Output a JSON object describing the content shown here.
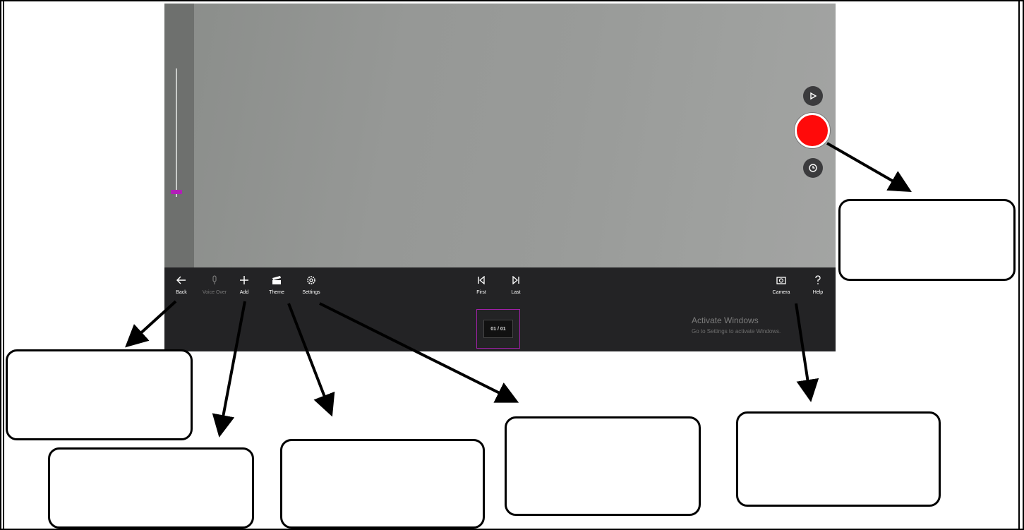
{
  "app": {
    "toolbar": {
      "back_label": "Back",
      "voice_over_label": "Voice Over",
      "add_label": "Add",
      "theme_label": "Theme",
      "settings_label": "Settings",
      "first_label": "First",
      "last_label": "Last",
      "camera_label": "Camera",
      "help_label": "Help"
    },
    "frame_counter": "01 / 01",
    "activation": {
      "title": "Activate Windows",
      "subtitle": "Go to Settings to activate Windows."
    },
    "colors": {
      "record": "#ff0a0a",
      "accent": "#b21fb8",
      "toolbar_bg": "#232325"
    },
    "icons": [
      "back-arrow-icon",
      "microphone-icon",
      "plus-icon",
      "clapper-icon",
      "gear-icon",
      "skip-first-icon",
      "skip-last-icon",
      "camera-icon",
      "help-icon",
      "play-icon",
      "timer-icon"
    ]
  },
  "callouts": {
    "record": "",
    "back": "",
    "add": "",
    "theme": "",
    "settings": "",
    "camera": ""
  }
}
